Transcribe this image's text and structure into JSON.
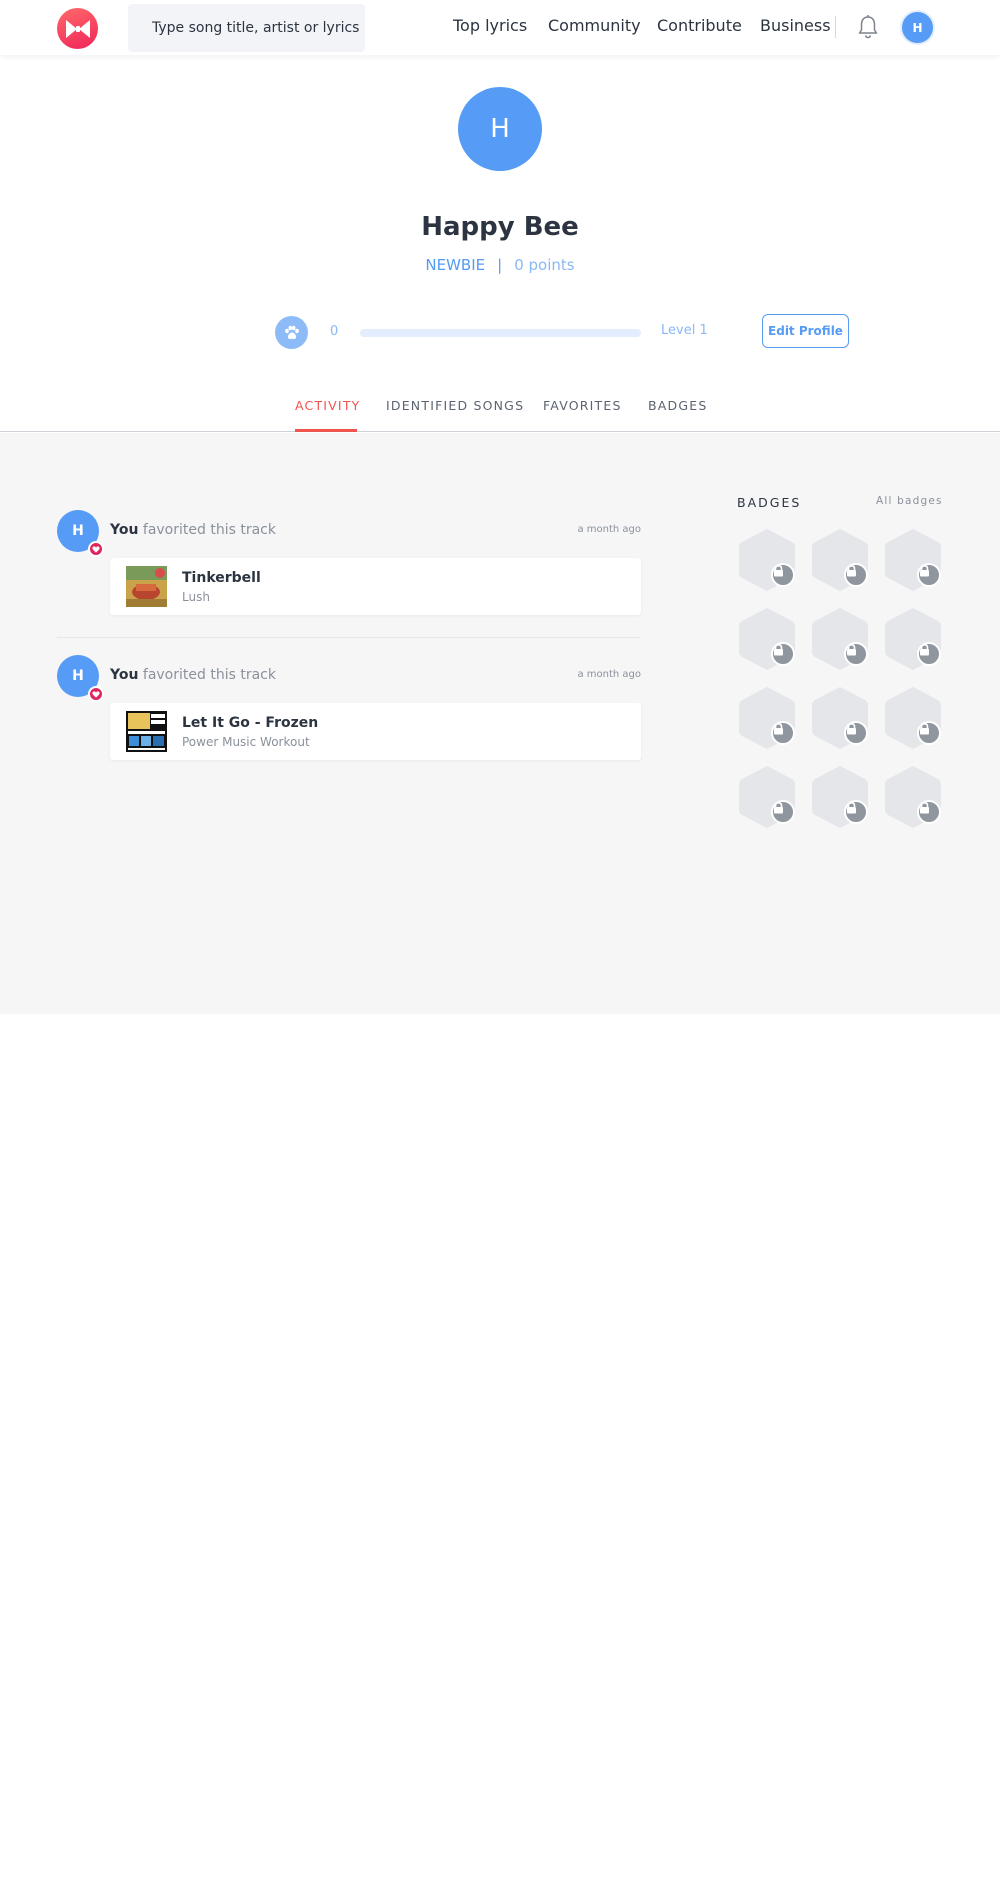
{
  "header": {
    "logo": "musixmatch-logo",
    "search_placeholder": "Type song title, artist or lyrics",
    "nav": [
      "Top lyrics",
      "Community",
      "Contribute",
      "Business"
    ],
    "avatar_initial": "H"
  },
  "profile": {
    "avatar_initial": "H",
    "name": "Happy Bee",
    "rank": "NEWBIE",
    "separator": "|",
    "points": "0 points",
    "level_points": "0",
    "level_progress": 0,
    "level_label": "Level 1",
    "edit_label": "Edit Profile"
  },
  "tabs": [
    {
      "label": "ACTIVITY",
      "active": true
    },
    {
      "label": "IDENTIFIED SONGS",
      "active": false
    },
    {
      "label": "FAVORITES",
      "active": false
    },
    {
      "label": "BADGES",
      "active": false
    }
  ],
  "activity": [
    {
      "avatar_initial": "H",
      "actor": "You",
      "action": "favorited this track",
      "time": "a month ago",
      "track": {
        "title": "Tinkerbell",
        "artist": "Lush"
      }
    },
    {
      "avatar_initial": "H",
      "actor": "You",
      "action": "favorited this track",
      "time": "a month ago",
      "track": {
        "title": "Let It Go - Frozen",
        "artist": "Power Music Workout"
      }
    }
  ],
  "badges": {
    "title": "BADGES",
    "all_label": "All badges",
    "count": 12,
    "state": "locked"
  },
  "colors": {
    "accent": "#569bf5",
    "tab_active": "#f0544f",
    "heart": "#e0245e",
    "content_bg": "#f6f6f7"
  }
}
